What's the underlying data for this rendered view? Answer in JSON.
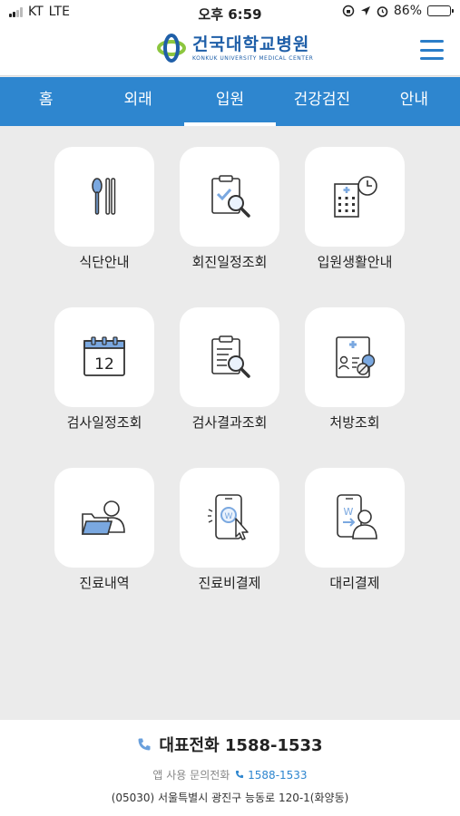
{
  "status_bar": {
    "carrier": "KT",
    "network": "LTE",
    "time": "오후 6:59",
    "battery": "86%",
    "battery_level": 0.86
  },
  "header": {
    "logo_name": "건국대학교병원",
    "logo_sub": "KONKUK UNIVERSITY MEDICAL CENTER"
  },
  "nav": {
    "tabs": [
      {
        "label": "홈"
      },
      {
        "label": "외래"
      },
      {
        "label": "입원"
      },
      {
        "label": "건강검진"
      },
      {
        "label": "안내"
      }
    ],
    "active_tab": "입원"
  },
  "menu": {
    "items": [
      {
        "label": "식단안내",
        "icon": "spoon-chopsticks-icon"
      },
      {
        "label": "회진일정조회",
        "icon": "clipboard-search-icon"
      },
      {
        "label": "입원생활안내",
        "icon": "hospital-clock-icon"
      },
      {
        "label": "검사일정조회",
        "icon": "calendar-icon"
      },
      {
        "label": "검사결과조회",
        "icon": "document-search-icon"
      },
      {
        "label": "처방조회",
        "icon": "prescription-icon"
      },
      {
        "label": "진료내역",
        "icon": "folder-user-icon"
      },
      {
        "label": "진료비결제",
        "icon": "phone-payment-icon"
      },
      {
        "label": "대리결제",
        "icon": "proxy-payment-icon"
      }
    ],
    "calendar_day": "12"
  },
  "footer": {
    "main_phone_label": "대표전화 1588-1533",
    "inquiry_label": "앱 사용 문의전화",
    "inquiry_number": "1588-1533",
    "address": "(05030) 서울특별시 광진구 능동로 120-1(화양동)"
  },
  "colors": {
    "accent": "#2e86cf",
    "icon_blue": "#5b8fd6",
    "background": "#ebebeb"
  }
}
